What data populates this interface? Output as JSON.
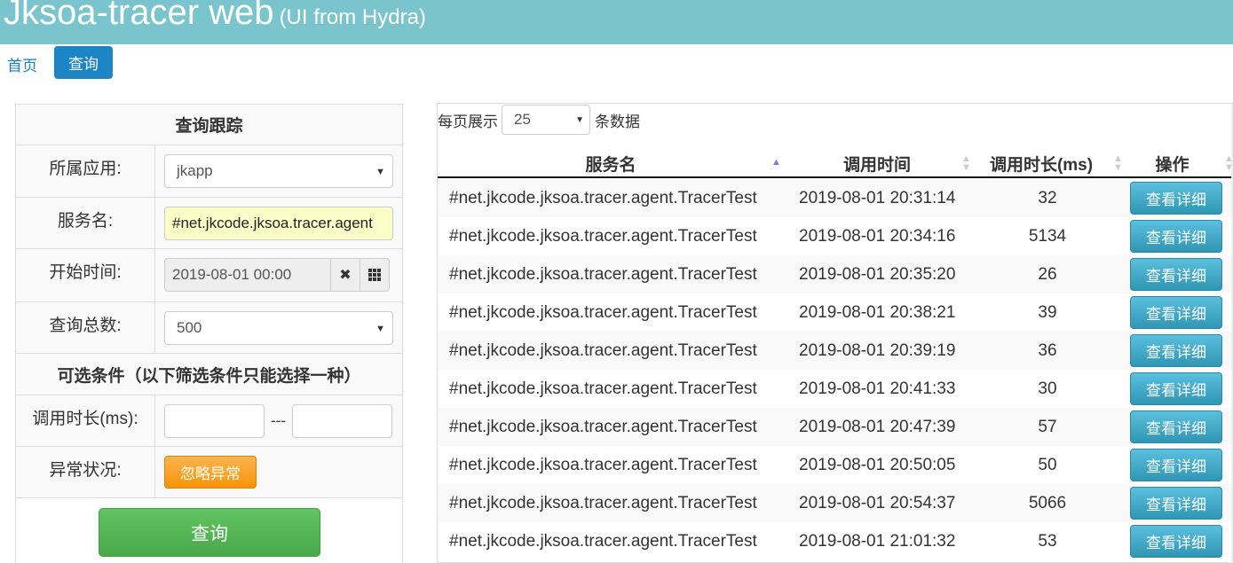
{
  "header": {
    "title": "Jksoa-tracer web",
    "subtitle": "(UI from Hydra)"
  },
  "nav": {
    "home": "首页",
    "query": "查询"
  },
  "form": {
    "title": "查询跟踪",
    "app_label": "所属应用:",
    "app_value": "jkapp",
    "service_label": "服务名:",
    "service_value": "#net.jkcode.jksoa.tracer.agent",
    "start_label": "开始时间:",
    "start_value": "2019-08-01 00:00",
    "total_label": "查询总数:",
    "total_value": "500",
    "optional_title": "可选条件（以下筛选条件只能选择一种）",
    "duration_label": "调用时长(ms):",
    "duration_sep": "---",
    "exception_label": "异常状况:",
    "exception_button": "忽略异常",
    "submit": "查询"
  },
  "table": {
    "per_page_prefix": "每页展示",
    "per_page_value": "25",
    "per_page_suffix": "条数据",
    "columns": [
      "服务名",
      "调用时间",
      "调用时长(ms)",
      "操作"
    ],
    "detail_button": "查看详细",
    "rows": [
      {
        "service": "#net.jkcode.jksoa.tracer.agent.TracerTest",
        "time": "2019-08-01 20:31:14",
        "duration": "32"
      },
      {
        "service": "#net.jkcode.jksoa.tracer.agent.TracerTest",
        "time": "2019-08-01 20:34:16",
        "duration": "5134"
      },
      {
        "service": "#net.jkcode.jksoa.tracer.agent.TracerTest",
        "time": "2019-08-01 20:35:20",
        "duration": "26"
      },
      {
        "service": "#net.jkcode.jksoa.tracer.agent.TracerTest",
        "time": "2019-08-01 20:38:21",
        "duration": "39"
      },
      {
        "service": "#net.jkcode.jksoa.tracer.agent.TracerTest",
        "time": "2019-08-01 20:39:19",
        "duration": "36"
      },
      {
        "service": "#net.jkcode.jksoa.tracer.agent.TracerTest",
        "time": "2019-08-01 20:41:33",
        "duration": "30"
      },
      {
        "service": "#net.jkcode.jksoa.tracer.agent.TracerTest",
        "time": "2019-08-01 20:47:39",
        "duration": "57"
      },
      {
        "service": "#net.jkcode.jksoa.tracer.agent.TracerTest",
        "time": "2019-08-01 20:50:05",
        "duration": "50"
      },
      {
        "service": "#net.jkcode.jksoa.tracer.agent.TracerTest",
        "time": "2019-08-01 20:54:37",
        "duration": "5066"
      },
      {
        "service": "#net.jkcode.jksoa.tracer.agent.TracerTest",
        "time": "2019-08-01 21:01:32",
        "duration": "53"
      }
    ]
  }
}
